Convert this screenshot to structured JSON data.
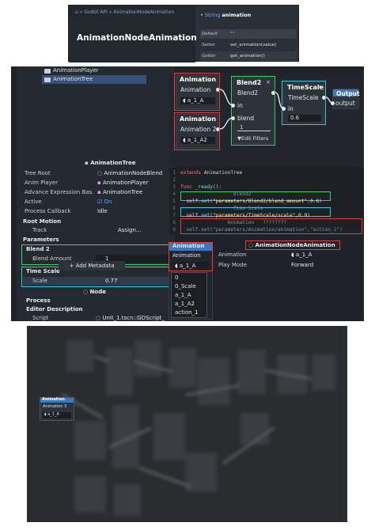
{
  "docs": {
    "breadcrumb": "⌂ » Godot API » AnimationNodeAnimation",
    "title": "AnimationNodeAnimation",
    "property": {
      "type": "String",
      "name": "animation"
    },
    "rows": [
      {
        "key": "Default",
        "value": "\"\""
      },
      {
        "key": "Setter",
        "value": "set_animation(value)"
      },
      {
        "key": "Getter",
        "value": "get_animation()"
      }
    ]
  },
  "scene_tree": {
    "items": [
      {
        "label": "AnimationPlayer",
        "selected": false
      },
      {
        "label": "AnimationTree",
        "selected": true
      }
    ]
  },
  "inspector": {
    "tab": "AnimationTree",
    "rows": [
      {
        "label": "Tree Root",
        "value": "AnimationNodeBlend"
      },
      {
        "label": "Anim Player",
        "value": "AnimationPlayer"
      },
      {
        "label": "Advance Expression Bas...",
        "value": "AnimationTree"
      },
      {
        "label": "Active",
        "value": "On"
      },
      {
        "label": "Process Callback",
        "value": "Idle"
      }
    ],
    "root_motion": "Root Motion",
    "track_label": "Track",
    "track_value": "Assign...",
    "parameters": "Parameters",
    "blend2_section": "Blend 2",
    "blend_amount_label": "Blend Amount",
    "blend_amount_value": "1",
    "time_scale_section": "Time Scale",
    "scale_label": "Scale",
    "scale_value": "0.77",
    "node_section": "Node",
    "process": "Process",
    "editor_description": "Editor Description",
    "script_label": "Script",
    "script_value": "Unit_1.tscn::GDScript_",
    "add_metadata": "Add Metadata"
  },
  "graph": {
    "anim1": {
      "title": "Animation",
      "port": "Animation",
      "value": "a_1_A"
    },
    "anim2": {
      "title": "Animation",
      "port": "Animation 2",
      "value": "a_1_A2"
    },
    "blend2": {
      "title": "Blend2",
      "port1": "Blend2",
      "port2": "in",
      "port3": "blend",
      "value": "1",
      "filters": "Edit Filters"
    },
    "timescale": {
      "title": "TimeScale",
      "port1": "TimeScale",
      "port2": "in",
      "value": "0.6"
    },
    "output": {
      "title": "Output",
      "port": "output"
    },
    "close": "×"
  },
  "code": {
    "lines": [
      {
        "n": "1",
        "parts": [
          [
            "kw2",
            "extends "
          ],
          [
            "tx",
            "AnimationTree"
          ]
        ]
      },
      {
        "n": "2",
        "parts": []
      },
      {
        "n": "3",
        "parts": [
          [
            "kw2",
            "func "
          ],
          [
            "fn",
            "_ready"
          ],
          [
            "tx",
            "():"
          ]
        ]
      },
      {
        "n": "4",
        "parts": [
          [
            "cm",
            "                  Blend2"
          ]
        ]
      },
      {
        "n": "5",
        "parts": [
          [
            "tx",
            "  self."
          ],
          [
            "fn",
            "set"
          ],
          [
            "tx",
            "("
          ],
          [
            "str",
            "\"parameters/Blend2/blend_amount\""
          ],
          [
            "tx",
            ","
          ],
          [
            "num",
            "0.8"
          ],
          [
            "tx",
            ")"
          ]
        ]
      },
      {
        "n": "6",
        "parts": [
          [
            "cm",
            "                  Time Scale"
          ]
        ]
      },
      {
        "n": "7",
        "parts": [
          [
            "tx",
            "  self."
          ],
          [
            "fn",
            "set"
          ],
          [
            "tx",
            "("
          ],
          [
            "str",
            "\"parameters/TimeScale/scale\""
          ],
          [
            "tx",
            ","
          ],
          [
            "num",
            "0.9"
          ],
          [
            "tx",
            ")"
          ]
        ]
      },
      {
        "n": "8",
        "parts": [
          [
            "cm",
            "                Animation   ????????"
          ]
        ]
      },
      {
        "n": "9",
        "parts": [
          [
            "cm",
            "  self.set(\"parameters/Animation/animation\",\"action_1\")"
          ]
        ]
      }
    ]
  },
  "anim_inspector": {
    "tab": "AnimationNodeAnimation",
    "animation_label": "Animation",
    "animation_value": "a_1_A",
    "play_mode_label": "Play Mode",
    "play_mode_value": "Forward"
  },
  "dropdown_node": {
    "title": "Animation",
    "port": "Animation",
    "value": "a_1_A",
    "options": [
      "0",
      "0_Scale",
      "a_1_A",
      "a_1_A2",
      "action_1"
    ]
  },
  "blurred_node": {
    "title": "Animation",
    "port": "Animation 3",
    "value": "a_1_A"
  },
  "colors": {
    "accent": "#3a78c2",
    "frame_red": "#e23c3c",
    "frame_green": "#3fcf6a",
    "frame_cyan": "#38c8e0"
  }
}
